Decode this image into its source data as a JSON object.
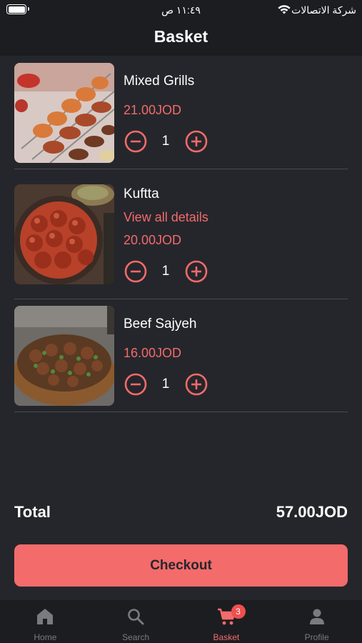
{
  "status_bar": {
    "time": "١١:٤٩ ص",
    "carrier": "شركة الاتصالات"
  },
  "header": {
    "title": "Basket"
  },
  "items": [
    {
      "name": "Mixed Grills",
      "link": "",
      "price": "21.00JOD",
      "quantity": "1",
      "image": "mixed-grills-photo"
    },
    {
      "name": "Kuftta",
      "link": "View all details",
      "price": "20.00JOD",
      "quantity": "1",
      "image": "kuftta-photo"
    },
    {
      "name": "Beef Sajyeh",
      "link": "",
      "price": "16.00JOD",
      "quantity": "1",
      "image": "beef-sajyeh-photo"
    }
  ],
  "summary": {
    "total_label": "Total",
    "total_value": "57.00JOD"
  },
  "checkout_label": "Checkout",
  "tabbar": {
    "tabs": [
      {
        "label": "Home",
        "icon": "home-icon"
      },
      {
        "label": "Search",
        "icon": "search-icon"
      },
      {
        "label": "Basket",
        "icon": "cart-icon",
        "badge": "3",
        "active": true
      },
      {
        "label": "Profile",
        "icon": "profile-icon"
      }
    ]
  },
  "colors": {
    "accent": "#f36b6b",
    "background": "#25262b",
    "bar": "#1c1d21"
  }
}
